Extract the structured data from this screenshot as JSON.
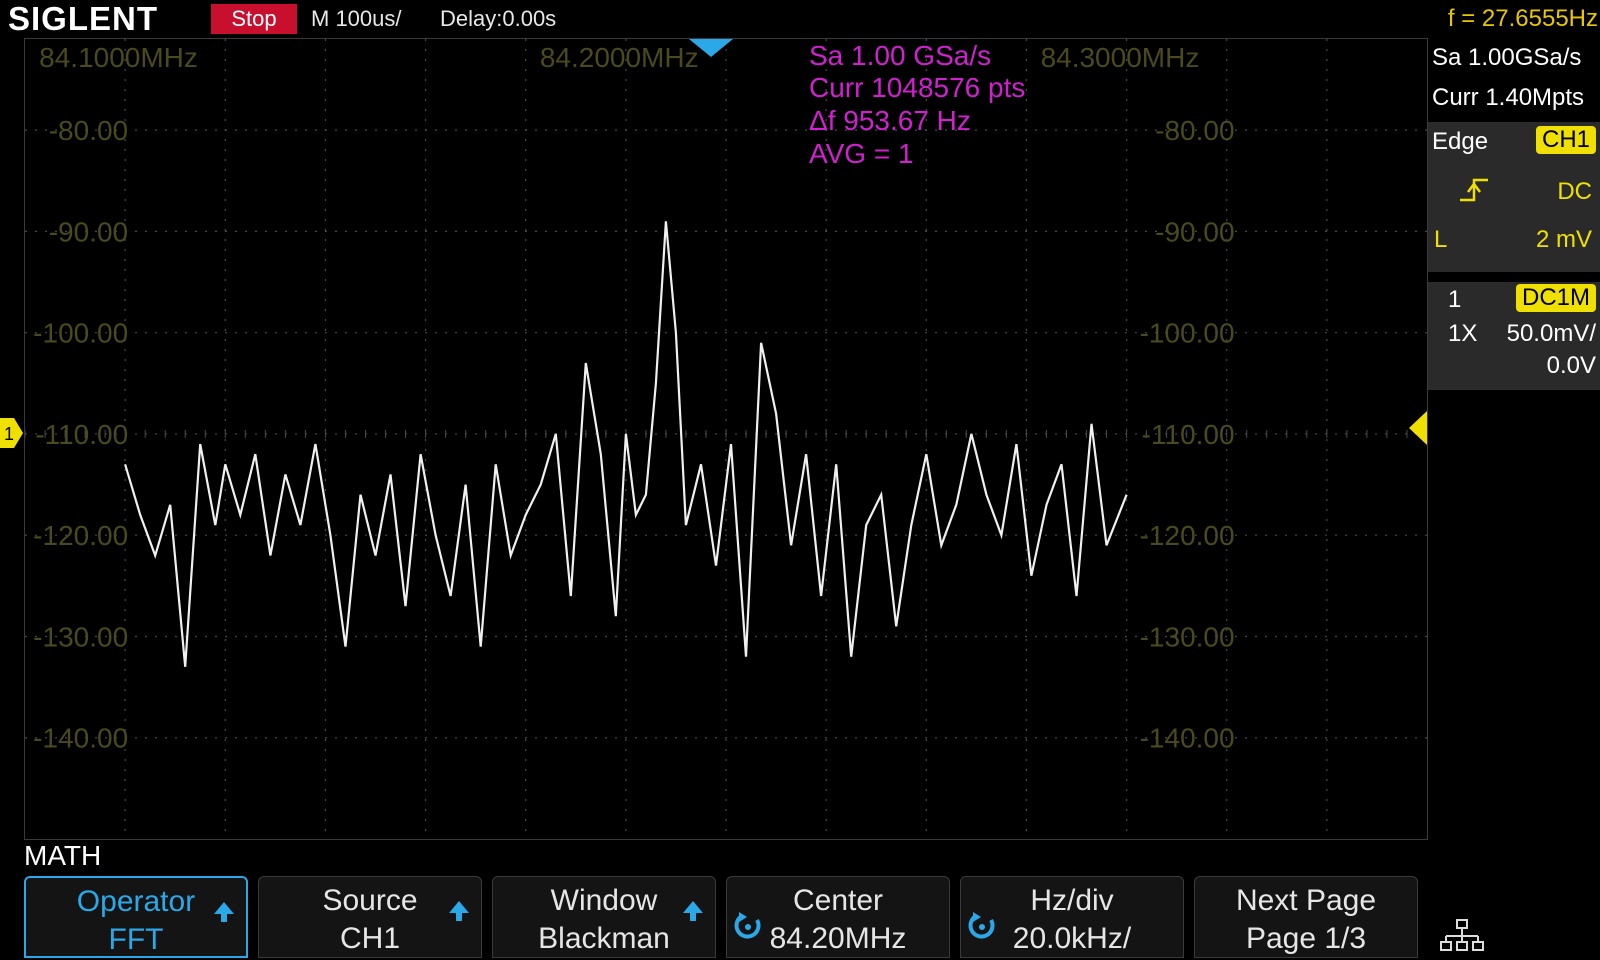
{
  "topbar": {
    "logo": "SIGLENT",
    "run_state": "Stop",
    "timebase": "M 100us/",
    "delay": "Delay:0.00s",
    "frequency_counter": "f = 27.6555Hz"
  },
  "fft_info": {
    "sample_rate": "Sa 1.00 GSa/s",
    "current_points": "Curr 1048576 pts",
    "delta_f": "Δf 953.67 Hz",
    "average": "AVG = 1"
  },
  "x_labels": [
    "84.1000MHz",
    "84.2000MHz",
    "84.3000MHz"
  ],
  "y_labels_left": [
    "-80.00",
    "-90.00",
    "-100.00",
    "-110.00",
    "-120.00",
    "-130.00",
    "-140.00"
  ],
  "y_labels_right": [
    "-80.00",
    "-90.00",
    "-100.00",
    "-110.00",
    "-120.00",
    "-130.00",
    "-140.00"
  ],
  "side_panel": {
    "sample_rate": "Sa 1.00GSa/s",
    "current_points": "Curr 1.40Mpts",
    "trigger": {
      "type": "Edge",
      "source": "CH1",
      "coupling": "DC",
      "level_label": "L",
      "level": "2 mV"
    },
    "channel": {
      "number": "1",
      "impedance": "DC1M",
      "probe": "1X",
      "scale": "50.0mV/",
      "offset": "0.0V"
    }
  },
  "channel_marker": "1",
  "menu_title": "MATH",
  "softkeys": [
    {
      "title": "Operator",
      "value": "FFT"
    },
    {
      "title": "Source",
      "value": "CH1"
    },
    {
      "title": "Window",
      "value": "Blackman"
    },
    {
      "title": "Center",
      "value": "84.20MHz"
    },
    {
      "title": "Hz/div",
      "value": "20.0kHz/"
    },
    {
      "title": "Next Page",
      "value": "Page 1/3"
    }
  ],
  "colors": {
    "grid_label": "#4a4a1e",
    "info_magenta": "#d020d0",
    "accent_yellow": "#f0e000",
    "accent_blue": "#2aa8e8",
    "trace": "#f0f0f0"
  },
  "chart_data": {
    "type": "line",
    "xlabel": "",
    "ylabel": "",
    "xlim": [
      84.08,
      84.36
    ],
    "ylim": [
      -150,
      -71
    ],
    "x_unit": "MHz",
    "y_unit": "dBm",
    "series": [
      {
        "x": [
          84.1,
          84.103,
          84.106,
          84.109,
          84.112,
          84.115,
          84.118,
          84.12,
          84.123,
          84.126,
          84.129,
          84.132,
          84.135,
          84.138,
          84.141,
          84.144,
          84.147,
          84.15,
          84.153,
          84.156,
          84.159,
          84.162,
          84.165,
          84.168,
          84.171,
          84.174,
          84.177,
          84.18,
          84.183,
          84.186,
          84.189,
          84.192,
          84.195,
          84.198,
          84.2,
          84.202,
          84.204,
          84.206,
          84.208,
          84.21,
          84.212,
          84.215,
          84.218,
          84.221,
          84.224,
          84.227,
          84.23,
          84.233,
          84.236,
          84.239,
          84.242,
          84.245,
          84.248,
          84.251,
          84.254,
          84.257,
          84.26,
          84.263,
          84.266,
          84.269,
          84.272,
          84.275,
          84.278,
          84.281,
          84.284,
          84.287,
          84.29,
          84.293,
          84.296,
          84.3
        ],
        "y": [
          -113,
          -118,
          -122,
          -117,
          -133,
          -111,
          -119,
          -113,
          -118,
          -112,
          -122,
          -114,
          -119,
          -111,
          -120,
          -131,
          -116,
          -122,
          -114,
          -127,
          -112,
          -120,
          -126,
          -115,
          -131,
          -113,
          -122,
          -118,
          -115,
          -110,
          -126,
          -103,
          -112,
          -128,
          -110,
          -118,
          -116,
          -105,
          -89,
          -100,
          -119,
          -113,
          -123,
          -111,
          -132,
          -101,
          -108,
          -121,
          -112,
          -126,
          -113,
          -132,
          -119,
          -116,
          -129,
          -119,
          -112,
          -121,
          -117,
          -110,
          -116,
          -120,
          -111,
          -124,
          -117,
          -113,
          -126,
          -109,
          -121,
          -116
        ]
      }
    ]
  }
}
